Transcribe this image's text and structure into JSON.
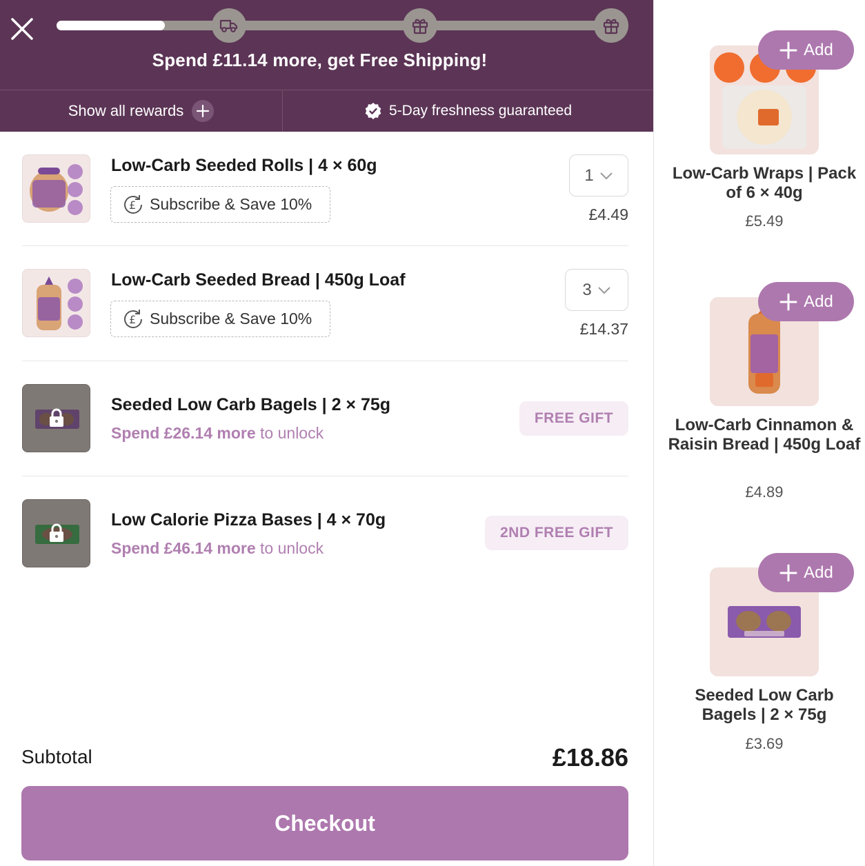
{
  "header": {
    "shipping_message": "Spend £11.14 more, get Free Shipping!",
    "progress": 0.19,
    "milestones": [
      {
        "icon": "truck-icon"
      },
      {
        "icon": "gift-icon"
      },
      {
        "icon": "gift-icon"
      }
    ],
    "show_rewards_label": "Show all rewards",
    "freshness_label": "5-Day freshness guaranteed"
  },
  "cart": {
    "items": [
      {
        "title": "Low-Carb Seeded Rolls | 4 × 60g",
        "subscribe_label": "Subscribe & Save 10%",
        "quantity": "1",
        "price": "£4.49"
      },
      {
        "title": "Low-Carb Seeded Bread | 450g Loaf",
        "subscribe_label": "Subscribe & Save 10%",
        "quantity": "3",
        "price": "£14.37"
      }
    ],
    "gifts": [
      {
        "title": "Seeded Low Carb Bagels | 2 × 75g",
        "unlock_amount": "Spend £26.14 more",
        "unlock_suffix": " to unlock",
        "tag": "FREE GIFT"
      },
      {
        "title": "Low Calorie Pizza Bases | 4 × 70g",
        "unlock_amount": "Spend £46.14 more",
        "unlock_suffix": " to unlock",
        "tag": "2ND FREE GIFT"
      }
    ],
    "subtotal_label": "Subtotal",
    "subtotal_value": "£18.86",
    "checkout_label": "Checkout"
  },
  "recommendations": [
    {
      "title": "Low-Carb Wraps | Pack of 6 × 40g",
      "price": "£5.49",
      "add_label": "Add"
    },
    {
      "title": "Low-Carb Cinnamon & Raisin Bread | 450g Loaf",
      "price": "£4.89",
      "add_label": "Add"
    },
    {
      "title": "Seeded Low Carb Bagels | 2 × 75g",
      "price": "£3.69",
      "add_label": "Add"
    }
  ],
  "colors": {
    "header_bg": "#5c3556",
    "accent": "#ad78ae",
    "gift_text": "#b07fb0"
  }
}
